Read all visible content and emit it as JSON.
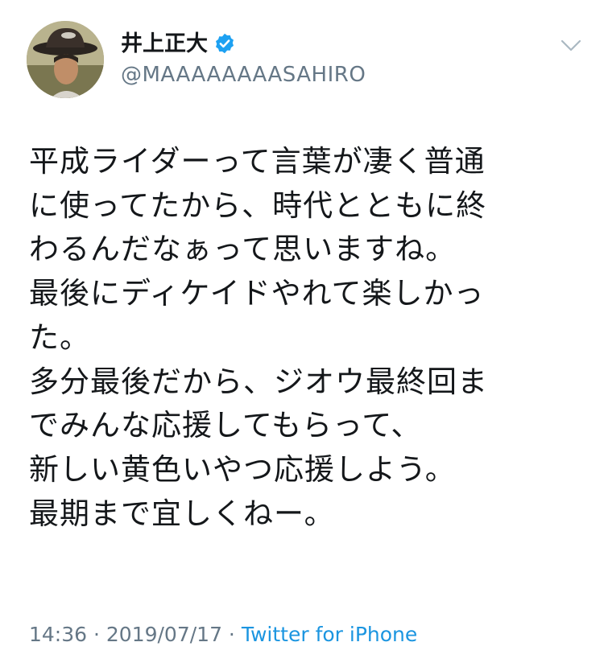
{
  "user": {
    "display_name": "井上正大",
    "handle": "@MAAAAAAAASAHIRO",
    "avatar": "avatar",
    "verified_icon": "verified-badge-icon"
  },
  "menu_icon": "chevron-down-icon",
  "tweet": {
    "text": "平成ライダーって言葉が凄く普通\nに使ってたから、時代とともに終\nわるんだなぁって思いますね。\n最後にディケイドやれて楽しかっ\nた。\n多分最後だから、ジオウ最終回ま\nでみんな応援してもらって、\n新しい黄色いやつ応援しよう。\n最期まで宜しくねー。"
  },
  "meta": {
    "time": "14:36",
    "separator_1": " · ",
    "date": "2019/07/17",
    "separator_2": " · ",
    "source": "Twitter for iPhone"
  },
  "colors": {
    "text": "#14171a",
    "secondary": "#657786",
    "link": "#1b95e0",
    "verified": "#1da1f2"
  }
}
